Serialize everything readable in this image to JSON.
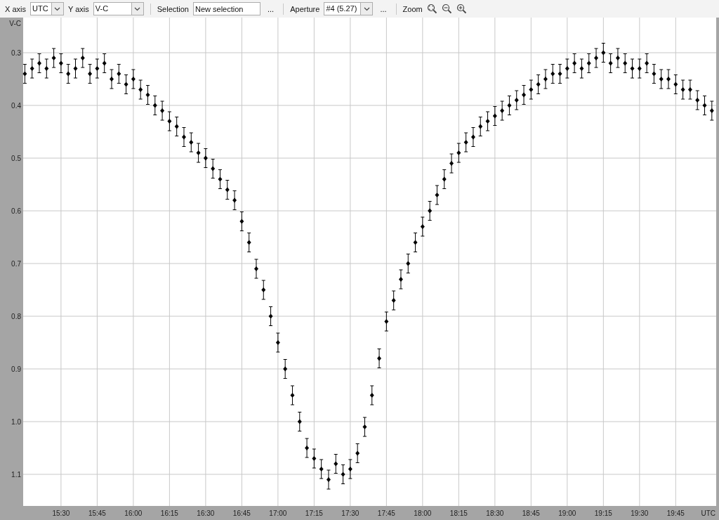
{
  "toolbar": {
    "x_axis": {
      "label": "X axis",
      "value": "UTC"
    },
    "y_axis": {
      "label": "Y axis",
      "value": "V-C"
    },
    "selection": {
      "label": "Selection",
      "value": "New selection",
      "more": "..."
    },
    "aperture": {
      "label": "Aperture",
      "value": "#4 (5.27)",
      "more": "..."
    },
    "zoom": {
      "label": "Zoom"
    }
  },
  "chart": {
    "chart_data": {
      "type": "scatter",
      "xlabel": "UTC",
      "ylabel": "V-C",
      "grid": true,
      "xlim": [
        914.3,
        1201.8
      ],
      "ylim": [
        1.16,
        0.2333
      ],
      "xticks": [
        {
          "value": 930,
          "label": "15:30"
        },
        {
          "value": 945,
          "label": "15:45"
        },
        {
          "value": 960,
          "label": "16:00"
        },
        {
          "value": 975,
          "label": "16:15"
        },
        {
          "value": 990,
          "label": "16:30"
        },
        {
          "value": 1005,
          "label": "16:45"
        },
        {
          "value": 1020,
          "label": "17:00"
        },
        {
          "value": 1035,
          "label": "17:15"
        },
        {
          "value": 1050,
          "label": "17:30"
        },
        {
          "value": 1065,
          "label": "17:45"
        },
        {
          "value": 1080,
          "label": "18:00"
        },
        {
          "value": 1095,
          "label": "18:15"
        },
        {
          "value": 1110,
          "label": "18:30"
        },
        {
          "value": 1125,
          "label": "18:45"
        },
        {
          "value": 1140,
          "label": "19:00"
        },
        {
          "value": 1155,
          "label": "19:15"
        },
        {
          "value": 1170,
          "label": "19:30"
        },
        {
          "value": 1185,
          "label": "19:45"
        }
      ],
      "yticks": [
        {
          "value": 0.3,
          "label": "0.3"
        },
        {
          "value": 0.4,
          "label": "0.4"
        },
        {
          "value": 0.5,
          "label": "0.5"
        },
        {
          "value": 0.6,
          "label": "0.6"
        },
        {
          "value": 0.7,
          "label": "0.7"
        },
        {
          "value": 0.8,
          "label": "0.8"
        },
        {
          "value": 0.9,
          "label": "0.9"
        },
        {
          "value": 1.0,
          "label": "1.0"
        },
        {
          "value": 1.1,
          "label": "1.1"
        }
      ],
      "x": [
        915,
        918,
        921,
        924,
        927,
        930,
        933,
        936,
        939,
        942,
        945,
        948,
        951,
        954,
        957,
        960,
        963,
        966,
        969,
        972,
        975,
        978,
        981,
        984,
        987,
        990,
        993,
        996,
        999,
        1002,
        1005,
        1008,
        1011,
        1014,
        1017,
        1020,
        1023,
        1026,
        1029,
        1032,
        1035,
        1038,
        1041,
        1044,
        1047,
        1050,
        1053,
        1056,
        1059,
        1062,
        1065,
        1068,
        1071,
        1074,
        1077,
        1080,
        1083,
        1086,
        1089,
        1092,
        1095,
        1098,
        1101,
        1104,
        1107,
        1110,
        1113,
        1116,
        1119,
        1122,
        1125,
        1128,
        1131,
        1134,
        1137,
        1140,
        1143,
        1146,
        1149,
        1152,
        1155,
        1158,
        1161,
        1164,
        1167,
        1170,
        1173,
        1176,
        1179,
        1182,
        1185,
        1188,
        1191,
        1194,
        1197,
        1200
      ],
      "series": [
        {
          "color": "#000000",
          "errors": [
            0.018,
            0.018,
            0.018,
            0.018,
            0.018,
            0.018,
            0.018,
            0.018,
            0.018,
            0.018,
            0.018,
            0.018,
            0.018,
            0.018,
            0.018,
            0.018,
            0.018,
            0.018,
            0.018,
            0.018,
            0.018,
            0.018,
            0.018,
            0.018,
            0.018,
            0.018,
            0.018,
            0.018,
            0.018,
            0.018,
            0.018,
            0.018,
            0.018,
            0.018,
            0.018,
            0.018,
            0.018,
            0.018,
            0.018,
            0.018,
            0.018,
            0.018,
            0.018,
            0.018,
            0.018,
            0.018,
            0.018,
            0.018,
            0.018,
            0.018,
            0.018,
            0.018,
            0.018,
            0.018,
            0.018,
            0.018,
            0.018,
            0.018,
            0.018,
            0.018,
            0.018,
            0.018,
            0.018,
            0.018,
            0.018,
            0.018,
            0.018,
            0.018,
            0.018,
            0.018,
            0.018,
            0.018,
            0.018,
            0.018,
            0.018,
            0.018,
            0.018,
            0.018,
            0.018,
            0.018,
            0.018,
            0.018,
            0.018,
            0.018,
            0.018,
            0.018,
            0.018,
            0.018,
            0.018,
            0.018,
            0.018,
            0.018,
            0.018,
            0.018,
            0.018,
            0.018
          ],
          "values": [
            0.34,
            0.33,
            0.32,
            0.33,
            0.31,
            0.32,
            0.34,
            0.33,
            0.31,
            0.34,
            0.33,
            0.32,
            0.35,
            0.34,
            0.36,
            0.35,
            0.37,
            0.38,
            0.4,
            0.41,
            0.43,
            0.44,
            0.46,
            0.47,
            0.49,
            0.5,
            0.52,
            0.54,
            0.56,
            0.58,
            0.62,
            0.66,
            0.71,
            0.75,
            0.8,
            0.85,
            0.9,
            0.95,
            1.0,
            1.05,
            1.07,
            1.09,
            1.11,
            1.08,
            1.1,
            1.09,
            1.06,
            1.01,
            0.95,
            0.88,
            0.81,
            0.77,
            0.73,
            0.7,
            0.66,
            0.63,
            0.6,
            0.57,
            0.54,
            0.51,
            0.49,
            0.47,
            0.46,
            0.44,
            0.43,
            0.42,
            0.41,
            0.4,
            0.39,
            0.38,
            0.37,
            0.36,
            0.35,
            0.34,
            0.34,
            0.33,
            0.32,
            0.33,
            0.32,
            0.31,
            0.3,
            0.32,
            0.31,
            0.32,
            0.33,
            0.33,
            0.32,
            0.34,
            0.35,
            0.35,
            0.36,
            0.37,
            0.37,
            0.39,
            0.4,
            0.41
          ]
        }
      ]
    }
  }
}
